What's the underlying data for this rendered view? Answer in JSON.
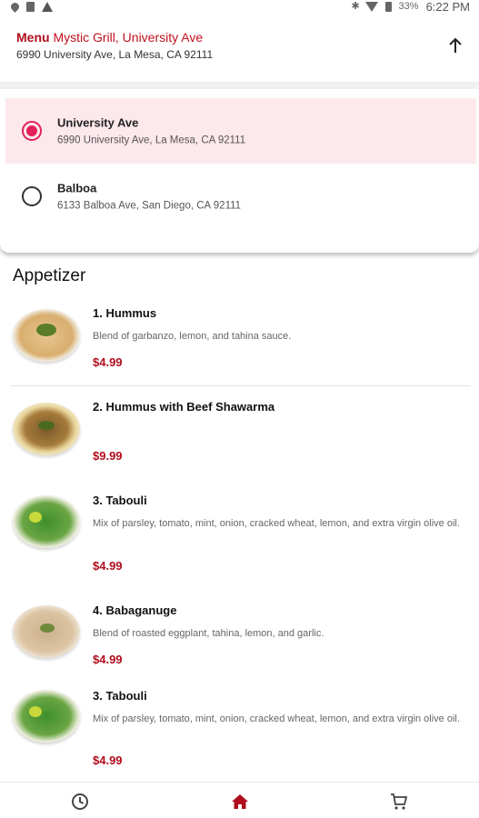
{
  "status_bar": {
    "battery_text": "33%",
    "time": "6:22 PM"
  },
  "header": {
    "menu_label": "Menu",
    "restaurant_location": "Mystic Grill, University Ave",
    "address": "6990 University Ave, La Mesa, CA 92111"
  },
  "locations": [
    {
      "name": "University Ave",
      "address": "6990 University Ave, La Mesa, CA 92111",
      "selected": true
    },
    {
      "name": "Balboa",
      "address": "6133 Balboa Ave, San Diego, CA 92111",
      "selected": false
    }
  ],
  "section": {
    "title": "Appetizer"
  },
  "items": [
    {
      "name": "1. Hummus",
      "description": "Blend of garbanzo, lemon, and tahina sauce.",
      "price": "$4.99",
      "image": "hummus"
    },
    {
      "name": "2. Hummus with Beef Shawarma",
      "description": "",
      "price": "$9.99",
      "image": "hummus-shawarma"
    },
    {
      "name": "3. Tabouli",
      "description": "Mix of parsley, tomato, mint, onion, cracked wheat, lemon, and extra virgin olive oil.",
      "price": "$4.99",
      "image": "tabouli"
    },
    {
      "name": "4. Babaganuge",
      "description": "Blend of roasted eggplant, tahina, lemon, and garlic.",
      "price": "$4.99",
      "image": "babaganuge"
    },
    {
      "name": "3. Tabouli",
      "description": "Mix of parsley, tomato, mint, onion, cracked wheat, lemon, and extra virgin olive oil.",
      "price": "$4.99",
      "image": "tabouli"
    }
  ],
  "bottom_nav": [
    {
      "icon": "clock-icon",
      "active": false
    },
    {
      "icon": "home-icon",
      "active": true
    },
    {
      "icon": "cart-icon",
      "active": false
    }
  ],
  "colors": {
    "accent": "#b00d1c",
    "radio_selected": "#e3215a",
    "selected_bg": "#fde8ec"
  }
}
